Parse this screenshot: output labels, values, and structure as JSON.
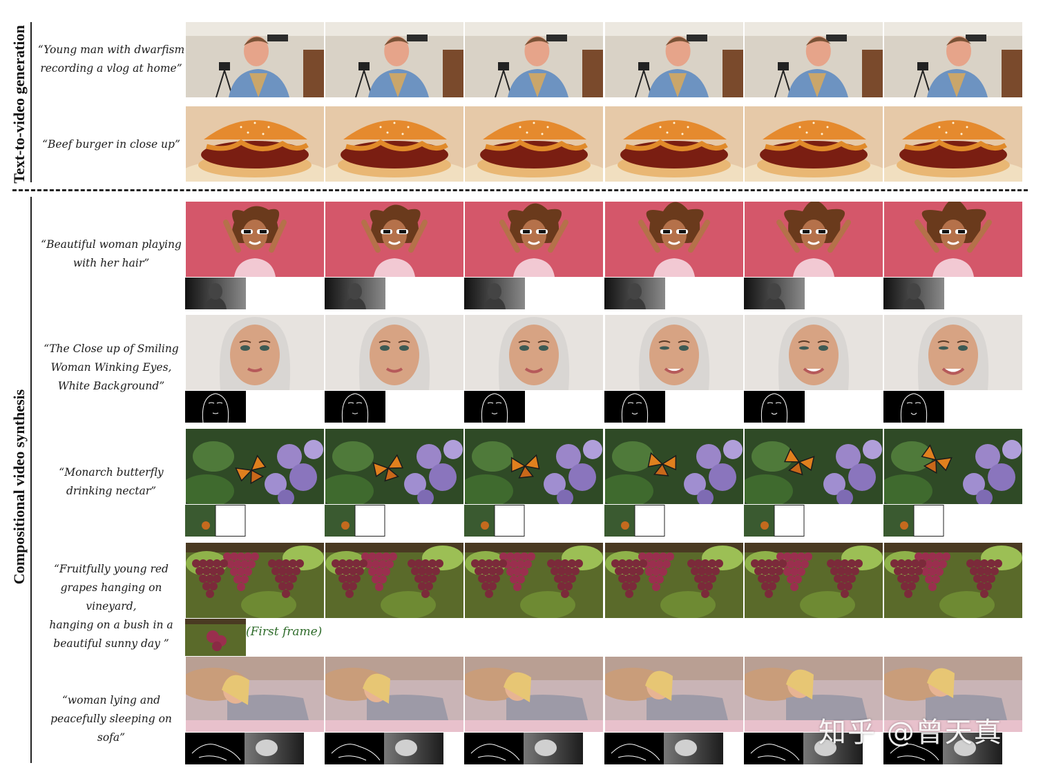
{
  "sections": {
    "t2v_label": "Text-to-video generation",
    "comp_label": "Compositional video synthesis"
  },
  "rows": [
    {
      "prompt_lines": [
        "“Young man with dwarfism",
        "recording a vlog at home”"
      ],
      "scene": "vlog",
      "condition": "none"
    },
    {
      "prompt_lines": [
        "“Beef burger in close up”"
      ],
      "scene": "burger",
      "condition": "none"
    },
    {
      "prompt_lines": [
        "“Beautiful woman playing",
        "with her hair”"
      ],
      "scene": "hair",
      "condition": "depth"
    },
    {
      "prompt_lines": [
        "“The Close up of Smiling",
        "Woman Winking Eyes,",
        "White Background”"
      ],
      "scene": "smile",
      "condition": "sketch"
    },
    {
      "prompt_lines": [
        "“Monarch butterfly",
        "drinking nectar”"
      ],
      "scene": "butterfly",
      "condition": "mask"
    },
    {
      "prompt_lines": [
        "“Fruitfully young red",
        "grapes hanging on vineyard,",
        "hanging on a bush in a",
        "beautiful sunny day ”"
      ],
      "scene": "grapes",
      "condition": "first-frame"
    },
    {
      "prompt_lines": [
        "“woman lying and",
        "peacefully sleeping on sofa”"
      ],
      "scene": "sofa",
      "condition": "sketch+depth"
    }
  ],
  "first_frame_note": "(First frame)",
  "watermark": "知乎 @曾天真",
  "colors": {
    "rule": "#222222",
    "note_green": "#2e6b2a",
    "hair_bg": "#d4576a",
    "smile_bg": "#e7e3df",
    "butterfly_bg": "#2f4a26",
    "grapes_bg": "#5a6a2a",
    "sofa_bg": "#c9b4b6"
  }
}
